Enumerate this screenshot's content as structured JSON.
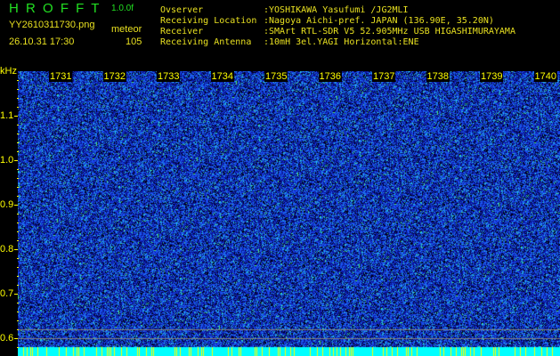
{
  "header": {
    "brand": "H R O F F T",
    "version": "1.0.0f",
    "filename": "YY2610311730.png",
    "datetime": "26.10.31 17:30",
    "mode": "meteor",
    "count": "105"
  },
  "station": [
    {
      "label": "Ovserver",
      "value": ":YOSHIKAWA Yasufumi /JG2MLI"
    },
    {
      "label": "Receiving Location",
      "value": ":Nagoya Aichi-pref. JAPAN (136.90E, 35.20N)"
    },
    {
      "label": "Receiver",
      "value": ":SMArt RTL-SDR V5 52.905MHz USB HIGASHIMURAYAMA"
    },
    {
      "label": "Receiving Antenna",
      "value": ":10mH 3el.YAGI Horizontal:ENE"
    }
  ],
  "spectrogram": {
    "y_unit": "kHz",
    "y_ticks": [
      "1.1",
      "1.0",
      "0.9",
      "0.8",
      "0.7",
      "0.6"
    ],
    "time_ticks": [
      "1731",
      "1732",
      "1733",
      "1734",
      "1735",
      "1736",
      "1737",
      "1738",
      "1739",
      "1740"
    ],
    "colors": {
      "background": "#000000",
      "noise_low": "#0a1aa0",
      "noise_mid": "#1e50f0",
      "noise_high": "#28d8e8",
      "bottom_band": "#00ffff",
      "marker": "#ffff00",
      "line": "#808080"
    }
  }
}
